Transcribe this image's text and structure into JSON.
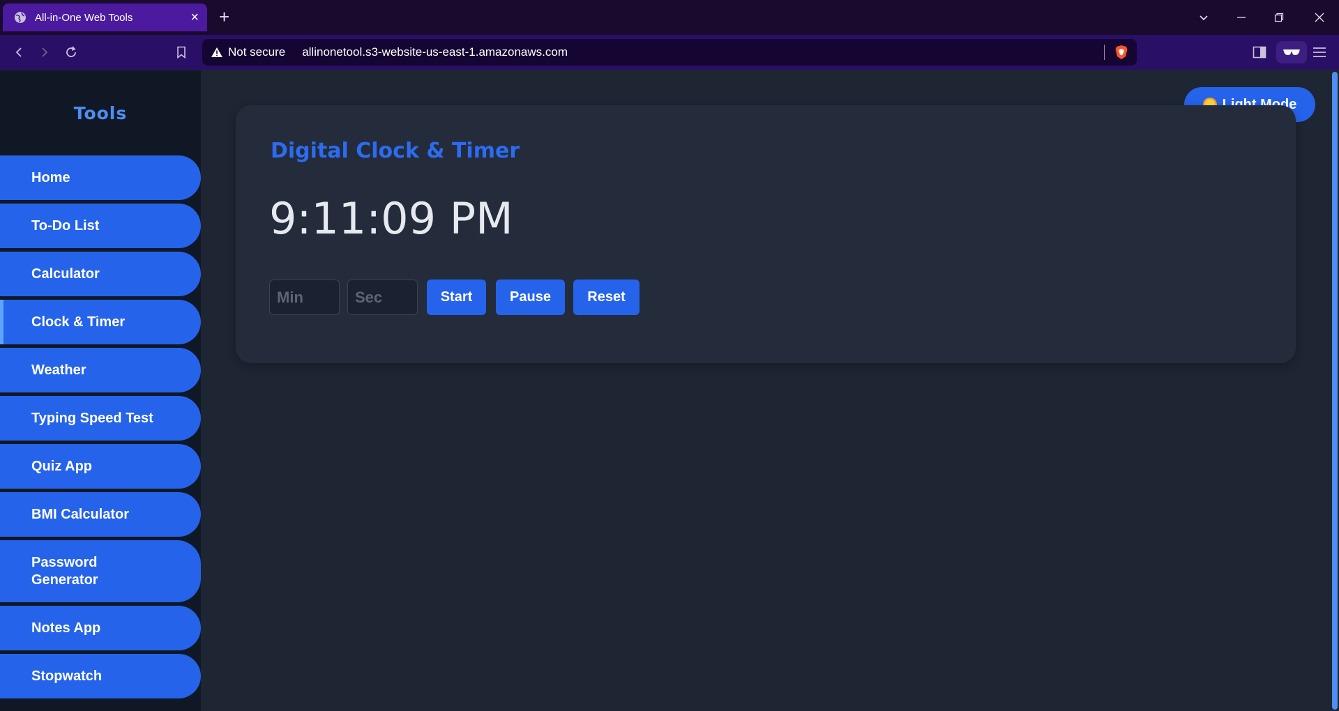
{
  "browser": {
    "tab_title": "All-in-One Web Tools",
    "security_label": "Not secure",
    "url": "allinonetool.s3-website-us-east-1.amazonaws.com"
  },
  "sidebar": {
    "title": "Tools",
    "items": [
      {
        "label": "Home"
      },
      {
        "label": "To-Do List"
      },
      {
        "label": "Calculator"
      },
      {
        "label": "Clock & Timer",
        "active": true
      },
      {
        "label": "Weather"
      },
      {
        "label": "Typing Speed Test"
      },
      {
        "label": "Quiz App"
      },
      {
        "label": "BMI Calculator"
      },
      {
        "label": "Password Generator"
      },
      {
        "label": "Notes App"
      },
      {
        "label": "Stopwatch"
      }
    ]
  },
  "theme_toggle": {
    "label": "Light Mode",
    "icon": "sun-icon"
  },
  "main": {
    "title": "Digital Clock & Timer",
    "time": "9:11:09 PM",
    "timer": {
      "minutes_placeholder": "Min",
      "seconds_placeholder": "Sec",
      "start_label": "Start",
      "pause_label": "Pause",
      "reset_label": "Reset"
    }
  },
  "colors": {
    "accent": "#2563eb",
    "sidebar_bg": "#101826",
    "page_bg": "#1e2533",
    "card_bg": "#242b3a",
    "tab_active": "#4b1a9e",
    "browser_toolbar": "#2a0f66"
  }
}
